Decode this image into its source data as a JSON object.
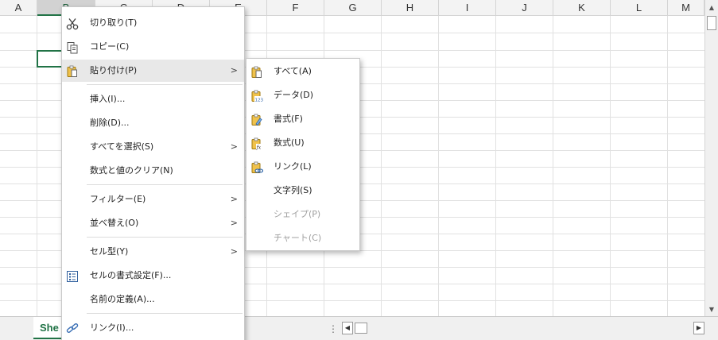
{
  "columns": [
    "A",
    "B",
    "C",
    "D",
    "E",
    "F",
    "G",
    "H",
    "I",
    "J",
    "K",
    "L",
    "M"
  ],
  "selected_column": "B",
  "sheet_tab": {
    "label": "She"
  },
  "scrollbar": {
    "up": "▲",
    "down": "▼",
    "left": "◀",
    "right": "▶",
    "splitter": "⋮"
  },
  "context_menu": {
    "cut": {
      "label": "切り取り(T)",
      "icon": "scissors-icon"
    },
    "copy": {
      "label": "コピー(C)",
      "icon": "copy-icon"
    },
    "paste": {
      "label": "貼り付け(P)",
      "icon": "clipboard-icon",
      "arrow": ">"
    },
    "insert": {
      "label": "挿入(I)..."
    },
    "delete": {
      "label": "削除(D)..."
    },
    "select_all": {
      "label": "すべてを選択(S)",
      "arrow": ">"
    },
    "clear": {
      "label": "数式と値のクリア(N)"
    },
    "filter": {
      "label": "フィルター(E)",
      "arrow": ">"
    },
    "sort": {
      "label": "並べ替え(O)",
      "arrow": ">"
    },
    "cell_type": {
      "label": "セル型(Y)",
      "arrow": ">"
    },
    "format_cells": {
      "label": "セルの書式設定(F)...",
      "icon": "format-cells-icon"
    },
    "define_name": {
      "label": "名前の定義(A)..."
    },
    "link": {
      "label": "リンク(I)...",
      "icon": "link-icon"
    }
  },
  "paste_submenu": {
    "all": {
      "label": "すべて(A)",
      "icon": "paste-all-icon"
    },
    "data": {
      "label": "データ(D)",
      "icon": "paste-values-icon",
      "badge": "123"
    },
    "format": {
      "label": "書式(F)",
      "icon": "paste-format-icon"
    },
    "formula": {
      "label": "数式(U)",
      "icon": "paste-formula-icon",
      "badge": "fx"
    },
    "link": {
      "label": "リンク(L)",
      "icon": "paste-link-icon"
    },
    "text": {
      "label": "文字列(S)"
    },
    "shape": {
      "label": "シェイプ(P)",
      "disabled": true
    },
    "chart": {
      "label": "チャート(C)",
      "disabled": true
    }
  },
  "colors": {
    "accent": "#217346",
    "grid": "#e1e1e1",
    "menu_hover": "#e8e8e8",
    "disabled": "#a0a0a0"
  }
}
